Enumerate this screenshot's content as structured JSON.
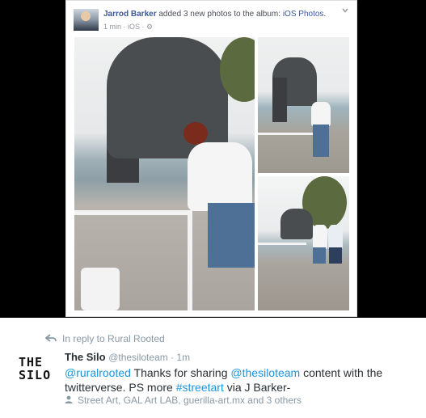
{
  "facebook_post": {
    "author": "Jarrod Barker",
    "action_text": " added 3 new photos to the album: ",
    "album": "iOS Photos",
    "album_suffix": ".",
    "meta": "1 min · iOS · ",
    "photos": [
      {
        "label": "statue-photo-main"
      },
      {
        "label": "statue-photo-top-right"
      },
      {
        "label": "statue-photo-bottom-right"
      }
    ]
  },
  "tweet": {
    "reply_to": "In reply to Rural Rooted",
    "avatar_lines": [
      "THE",
      "SILO"
    ],
    "name": "The Silo",
    "handle": "@thesiloteam",
    "separator": " · ",
    "time": "1m",
    "text_parts": {
      "mention1": "@ruralrooted",
      "t1": " Thanks for sharing ",
      "mention2": "@thesiloteam",
      "t2": " content with the twitterverse. PS more ",
      "hashtag": "#streetart",
      "t3": " via J Barker-"
    },
    "tagged": "Street Art, GAL Art LAB, guerilla-art.mx and 3 others"
  }
}
